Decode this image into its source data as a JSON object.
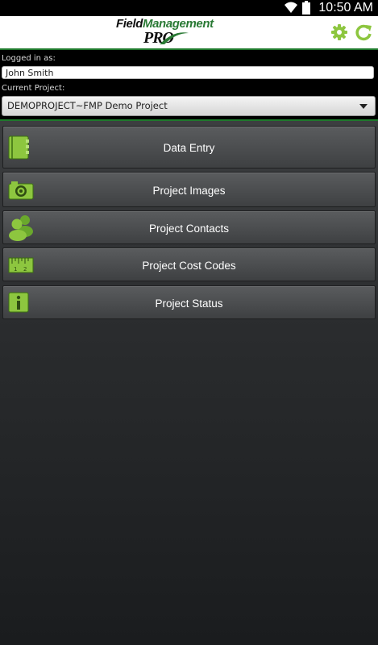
{
  "status_bar": {
    "time": "10:50 AM",
    "icons": [
      "wifi-icon",
      "battery-icon"
    ]
  },
  "header": {
    "logo_line1_a": "Field",
    "logo_line1_b": "Management",
    "logo_line2": "PRO",
    "settings_icon": "gear-icon",
    "refresh_icon": "refresh-icon",
    "accent_color": "#8dc63f",
    "divider_color": "#1f7a2c"
  },
  "login": {
    "label": "Logged in as:",
    "user": "John Smith"
  },
  "project": {
    "label": "Current Project:",
    "selected": "DEMOPROJECT~FMP Demo Project"
  },
  "menu": [
    {
      "label": "Data Entry",
      "icon": "notebook-icon"
    },
    {
      "label": "Project Images",
      "icon": "camera-icon"
    },
    {
      "label": "Project Contacts",
      "icon": "contacts-icon"
    },
    {
      "label": "Project Cost Codes",
      "icon": "ruler-icon"
    },
    {
      "label": "Project Status",
      "icon": "info-icon"
    }
  ]
}
